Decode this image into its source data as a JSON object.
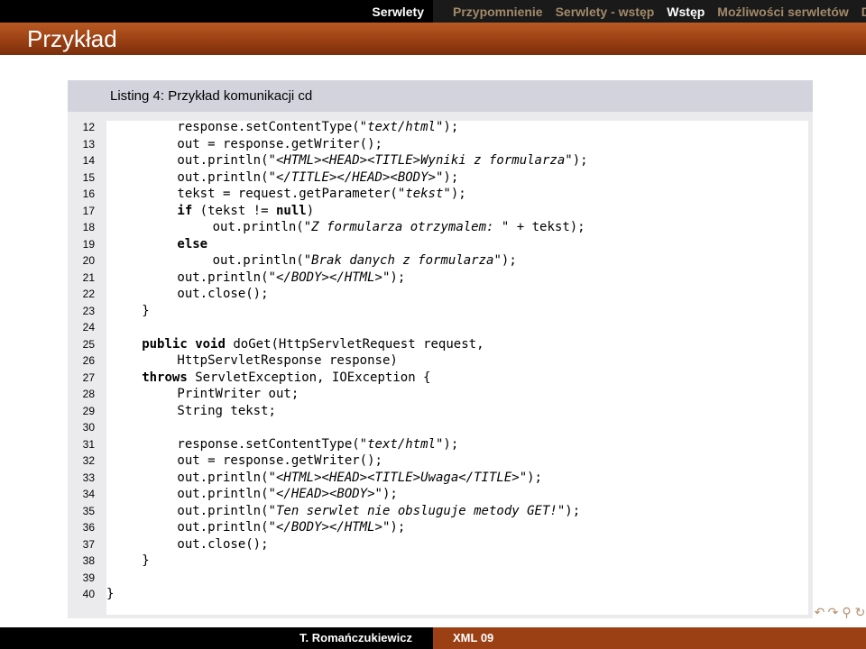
{
  "header": {
    "section": "Serwlety",
    "subsections": [
      {
        "label": "Przypomnienie",
        "active": false
      },
      {
        "label": "Serwlety - wstęp",
        "active": false
      },
      {
        "label": "Wstęp",
        "active": true
      },
      {
        "label": "Możliwości serwletów",
        "active": false
      },
      {
        "label": "Dzielen",
        "active": false
      }
    ]
  },
  "frame": {
    "title": "Przykład"
  },
  "listing": {
    "caption": "Listing 4: Przykład komunikacji cd",
    "lines": [
      {
        "num": "12",
        "indent": 8,
        "tokens": [
          {
            "t": "response.setContentType(\""
          },
          {
            "t": "text/html",
            "s": "str"
          },
          {
            "t": "\");"
          }
        ]
      },
      {
        "num": "13",
        "indent": 8,
        "tokens": [
          {
            "t": "out = response.getWriter();"
          }
        ]
      },
      {
        "num": "14",
        "indent": 8,
        "tokens": [
          {
            "t": "out.println(\""
          },
          {
            "t": "<HTML><HEAD><TITLE>Wyniki z formularza",
            "s": "str"
          },
          {
            "t": "\");"
          }
        ]
      },
      {
        "num": "15",
        "indent": 8,
        "tokens": [
          {
            "t": "out.println(\""
          },
          {
            "t": "</TITLE></HEAD><BODY>",
            "s": "str"
          },
          {
            "t": "\");"
          }
        ]
      },
      {
        "num": "16",
        "indent": 8,
        "tokens": [
          {
            "t": "tekst = request.getParameter(\""
          },
          {
            "t": "tekst",
            "s": "str"
          },
          {
            "t": "\");"
          }
        ]
      },
      {
        "num": "17",
        "indent": 8,
        "tokens": [
          {
            "t": "if",
            "s": "kw"
          },
          {
            "t": " (tekst != "
          },
          {
            "t": "null",
            "s": "kw"
          },
          {
            "t": ")"
          }
        ]
      },
      {
        "num": "18",
        "indent": 12,
        "tokens": [
          {
            "t": "out.println(\""
          },
          {
            "t": "Z formularza otrzymalem: ",
            "s": "str"
          },
          {
            "t": "\" + tekst);"
          }
        ]
      },
      {
        "num": "19",
        "indent": 8,
        "tokens": [
          {
            "t": "else",
            "s": "kw"
          }
        ]
      },
      {
        "num": "20",
        "indent": 12,
        "tokens": [
          {
            "t": "out.println(\""
          },
          {
            "t": "Brak danych z formularza",
            "s": "str"
          },
          {
            "t": "\");"
          }
        ]
      },
      {
        "num": "21",
        "indent": 8,
        "tokens": [
          {
            "t": "out.println(\""
          },
          {
            "t": "</BODY></HTML>",
            "s": "str"
          },
          {
            "t": "\");"
          }
        ]
      },
      {
        "num": "22",
        "indent": 8,
        "tokens": [
          {
            "t": "out.close();"
          }
        ]
      },
      {
        "num": "23",
        "indent": 4,
        "tokens": [
          {
            "t": "}"
          }
        ]
      },
      {
        "num": "24",
        "indent": 0,
        "tokens": []
      },
      {
        "num": "25",
        "indent": 4,
        "tokens": [
          {
            "t": "public",
            "s": "kw"
          },
          {
            "t": " "
          },
          {
            "t": "void",
            "s": "kw"
          },
          {
            "t": " doGet(HttpServletRequest request,"
          }
        ]
      },
      {
        "num": "26",
        "indent": 8,
        "tokens": [
          {
            "t": "HttpServletResponse response)"
          }
        ]
      },
      {
        "num": "27",
        "indent": 4,
        "tokens": [
          {
            "t": "throws",
            "s": "kw"
          },
          {
            "t": " ServletException, IOException {"
          }
        ]
      },
      {
        "num": "28",
        "indent": 8,
        "tokens": [
          {
            "t": "PrintWriter out;"
          }
        ]
      },
      {
        "num": "29",
        "indent": 8,
        "tokens": [
          {
            "t": "String tekst;"
          }
        ]
      },
      {
        "num": "30",
        "indent": 0,
        "tokens": []
      },
      {
        "num": "31",
        "indent": 8,
        "tokens": [
          {
            "t": "response.setContentType(\""
          },
          {
            "t": "text/html",
            "s": "str"
          },
          {
            "t": "\");"
          }
        ]
      },
      {
        "num": "32",
        "indent": 8,
        "tokens": [
          {
            "t": "out = response.getWriter();"
          }
        ]
      },
      {
        "num": "33",
        "indent": 8,
        "tokens": [
          {
            "t": "out.println(\""
          },
          {
            "t": "<HTML><HEAD><TITLE>Uwaga</TITLE>",
            "s": "str"
          },
          {
            "t": "\");"
          }
        ]
      },
      {
        "num": "34",
        "indent": 8,
        "tokens": [
          {
            "t": "out.println(\""
          },
          {
            "t": "</HEAD><BODY>",
            "s": "str"
          },
          {
            "t": "\");"
          }
        ]
      },
      {
        "num": "35",
        "indent": 8,
        "tokens": [
          {
            "t": "out.println(\""
          },
          {
            "t": "Ten serwlet nie obsluguje metody GET!",
            "s": "str"
          },
          {
            "t": "\");"
          }
        ]
      },
      {
        "num": "36",
        "indent": 8,
        "tokens": [
          {
            "t": "out.println(\""
          },
          {
            "t": "</BODY></HTML>",
            "s": "str"
          },
          {
            "t": "\");"
          }
        ]
      },
      {
        "num": "37",
        "indent": 8,
        "tokens": [
          {
            "t": "out.close();"
          }
        ]
      },
      {
        "num": "38",
        "indent": 4,
        "tokens": [
          {
            "t": "}"
          }
        ]
      },
      {
        "num": "39",
        "indent": 0,
        "tokens": []
      },
      {
        "num": "40",
        "indent": 0,
        "tokens": [
          {
            "t": "}"
          }
        ]
      }
    ]
  },
  "nav_icons": [
    {
      "name": "nav-prev-icon",
      "glyph": "↶"
    },
    {
      "name": "nav-next-icon",
      "glyph": "↷"
    },
    {
      "name": "nav-search-icon",
      "glyph": "⚲"
    },
    {
      "name": "nav-loop-icon",
      "glyph": "↻"
    }
  ],
  "footer": {
    "author": "T. Romańczukiewicz",
    "course": "XML 09"
  }
}
